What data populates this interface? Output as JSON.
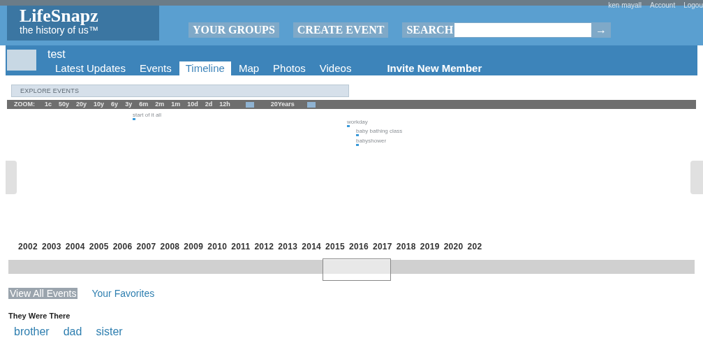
{
  "top_links": [
    "ken mayall",
    "Account",
    "Logou"
  ],
  "logo": {
    "name": "LifeSnapz",
    "tagline": "the history of us™"
  },
  "nav": [
    "YOUR GROUPS",
    "CREATE EVENT"
  ],
  "search": {
    "label": "SEARCH",
    "button": "→"
  },
  "group": {
    "name": "test"
  },
  "tabs": [
    {
      "label": "Latest Updates",
      "selected": false
    },
    {
      "label": "Events",
      "selected": false
    },
    {
      "label": "Timeline",
      "selected": true
    },
    {
      "label": "Map",
      "selected": false
    },
    {
      "label": "Photos",
      "selected": false
    },
    {
      "label": "Videos",
      "selected": false
    }
  ],
  "invite": "Invite New Member",
  "explore": {
    "title": "EXPLORE EVENTS"
  },
  "zoom": {
    "label": "ZOOM:",
    "levels": [
      "1c",
      "50y",
      "20y",
      "10y",
      "6y",
      "3y",
      "6m",
      "2m",
      "1m",
      "10d",
      "2d",
      "12h"
    ],
    "range": "20Years"
  },
  "events": [
    {
      "label": "start of it all"
    },
    {
      "label": "workday"
    },
    {
      "label": "baby bathing class"
    },
    {
      "label": "babyshower"
    }
  ],
  "years": [
    "2002",
    "2003",
    "2004",
    "2005",
    "2006",
    "2007",
    "2008",
    "2009",
    "2010",
    "2011",
    "2012",
    "2013",
    "2014",
    "2015",
    "2016",
    "2017",
    "2018",
    "2019",
    "2020",
    "202"
  ],
  "filters": [
    {
      "label": "View All Events",
      "selected": true
    },
    {
      "label": "Your Favorites",
      "selected": false
    }
  ],
  "people": {
    "title": "They Were There",
    "names": [
      "brother",
      "dad",
      "sister"
    ]
  }
}
